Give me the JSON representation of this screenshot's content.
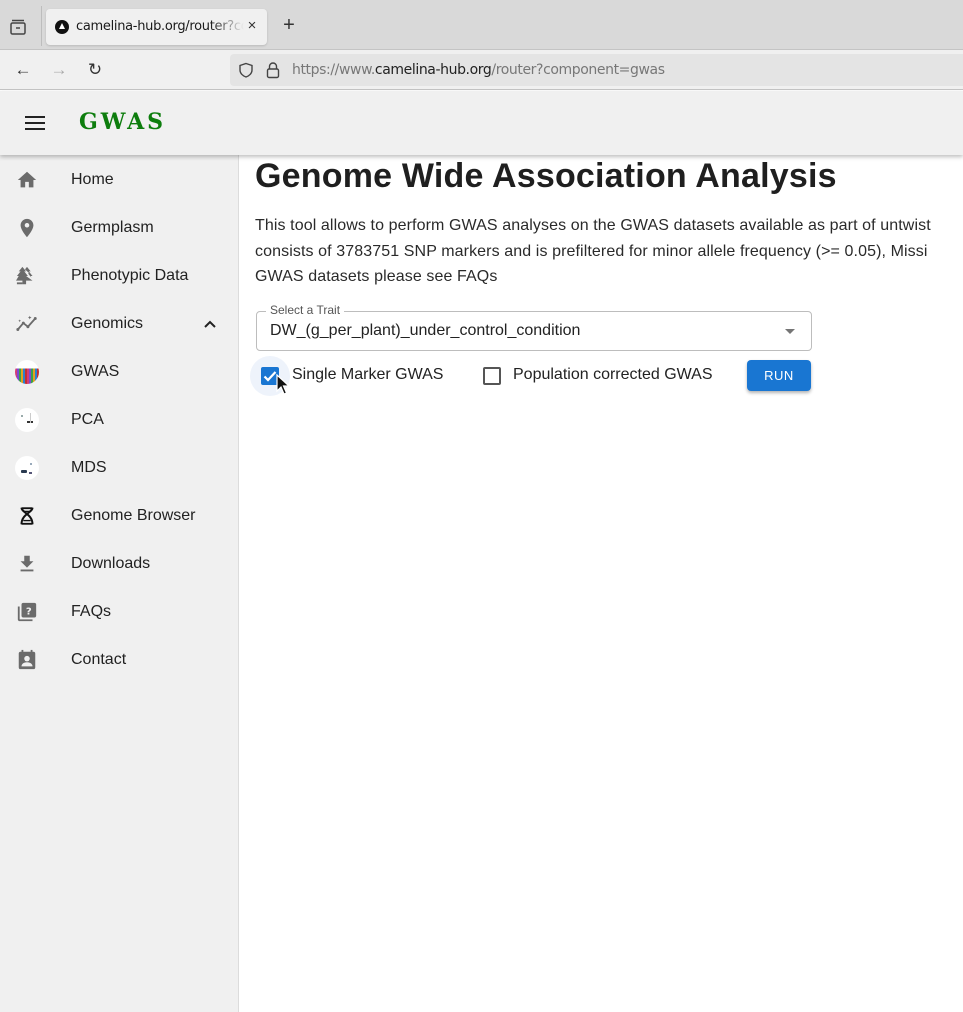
{
  "browser": {
    "tab_title": "camelina-hub.org/router?component=gwas",
    "url_prefix": "https://www.",
    "url_domain": "camelina-hub.org",
    "url_path": "/router?component=gwas",
    "close_glyph": "×",
    "new_tab_glyph": "+",
    "back_glyph": "←",
    "forward_glyph": "→",
    "reload_glyph": "↻"
  },
  "app": {
    "title": "GWAS",
    "title_color": "#0d7d0d"
  },
  "sidebar": {
    "items": [
      {
        "label": "Home",
        "icon": "home-icon"
      },
      {
        "label": "Germplasm",
        "icon": "location-pin-icon"
      },
      {
        "label": "Phenotypic Data",
        "icon": "forest-icon"
      },
      {
        "label": "Genomics",
        "icon": "insights-icon",
        "expanded": true
      },
      {
        "label": "GWAS",
        "icon": "gwas-thumbnail-icon"
      },
      {
        "label": "PCA",
        "icon": "pca-thumbnail-icon"
      },
      {
        "label": "MDS",
        "icon": "mds-thumbnail-icon"
      },
      {
        "label": "Genome Browser",
        "icon": "dna-icon"
      },
      {
        "label": "Downloads",
        "icon": "download-icon"
      },
      {
        "label": "FAQs",
        "icon": "quiz-icon"
      },
      {
        "label": "Contact",
        "icon": "contact-icon"
      }
    ]
  },
  "main": {
    "title": "Genome Wide Association Analysis",
    "description_lines": [
      "This tool allows to perform GWAS analyses on the GWAS datasets available as part of untwist",
      "consists of 3783751 SNP markers and is prefiltered for minor allele frequency (>= 0.05), Missi",
      "GWAS datasets please see FAQs"
    ],
    "trait_select": {
      "label": "Select a Trait",
      "value": "DW_(g_per_plant)_under_control_condition"
    },
    "options": [
      {
        "label": "Single Marker GWAS",
        "checked": true
      },
      {
        "label": "Population corrected GWAS",
        "checked": false
      }
    ],
    "run_label": "RUN",
    "accent_color": "#1976d2"
  }
}
